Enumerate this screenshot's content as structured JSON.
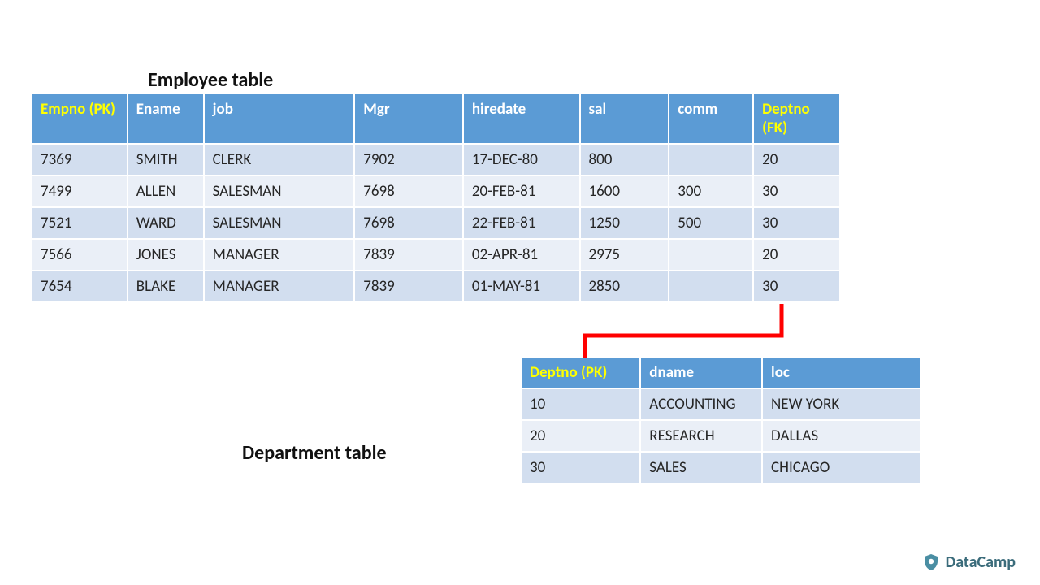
{
  "employee": {
    "title": "Employee table",
    "headers": [
      {
        "label": "Empno (PK)",
        "key": true
      },
      {
        "label": "Ename",
        "key": false
      },
      {
        "label": "job",
        "key": false
      },
      {
        "label": "Mgr",
        "key": false
      },
      {
        "label": "hiredate",
        "key": false
      },
      {
        "label": "sal",
        "key": false
      },
      {
        "label": "comm",
        "key": false
      },
      {
        "label": "Deptno (FK)",
        "key": true
      }
    ],
    "rows": [
      [
        "7369",
        "SMITH",
        "CLERK",
        "7902",
        "17-DEC-80",
        "800",
        "",
        "20"
      ],
      [
        "7499",
        "ALLEN",
        "SALESMAN",
        "7698",
        "20-FEB-81",
        "1600",
        "300",
        "30"
      ],
      [
        "7521",
        "WARD",
        "SALESMAN",
        "7698",
        "22-FEB-81",
        "1250",
        "500",
        "30"
      ],
      [
        "7566",
        "JONES",
        "MANAGER",
        "7839",
        "02-APR-81",
        "2975",
        "",
        "20"
      ],
      [
        "7654",
        "BLAKE",
        "MANAGER",
        "7839",
        "01-MAY-81",
        "2850",
        "",
        "30"
      ]
    ]
  },
  "department": {
    "title": "Department table",
    "headers": [
      {
        "label": "Deptno (PK)",
        "key": true
      },
      {
        "label": "dname",
        "key": false
      },
      {
        "label": "loc",
        "key": false
      }
    ],
    "rows": [
      [
        "10",
        "ACCOUNTING",
        "NEW YORK"
      ],
      [
        "20",
        "RESEARCH",
        "DALLAS"
      ],
      [
        "30",
        "SALES",
        "CHICAGO"
      ]
    ]
  },
  "brand": {
    "name": "DataCamp"
  },
  "colors": {
    "header_bg": "#5b9bd5",
    "header_fg": "#ffffff",
    "key_fg": "#ffff00",
    "row_even": "#d2deef",
    "row_odd": "#eaeff7",
    "connector": "#ff0000"
  }
}
